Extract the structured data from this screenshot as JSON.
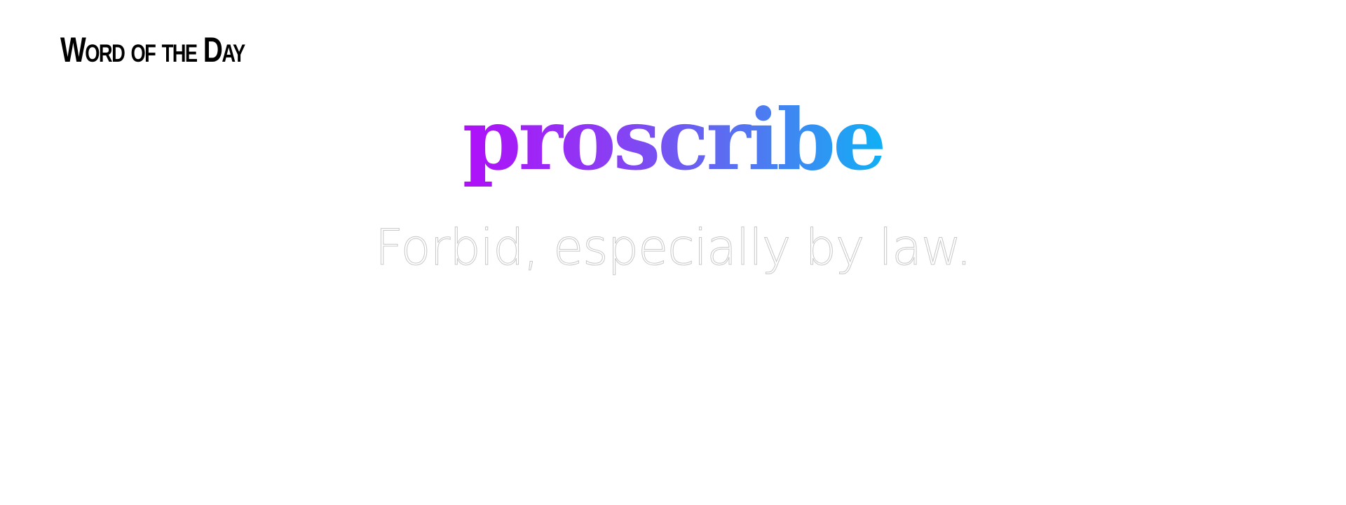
{
  "header": {
    "title": "Word of the Day"
  },
  "word": {
    "text": "proscribe",
    "gradient_colors": [
      "#b00ef9",
      "#8a3ef3",
      "#4f79f1",
      "#10b0f5"
    ]
  },
  "definition": {
    "text": "Forbid, especially by law."
  },
  "colors": {
    "background": "#ffffff",
    "header_text": "#000000",
    "definition_fill": "#ffffff",
    "definition_outline": "#c8c8c8"
  }
}
